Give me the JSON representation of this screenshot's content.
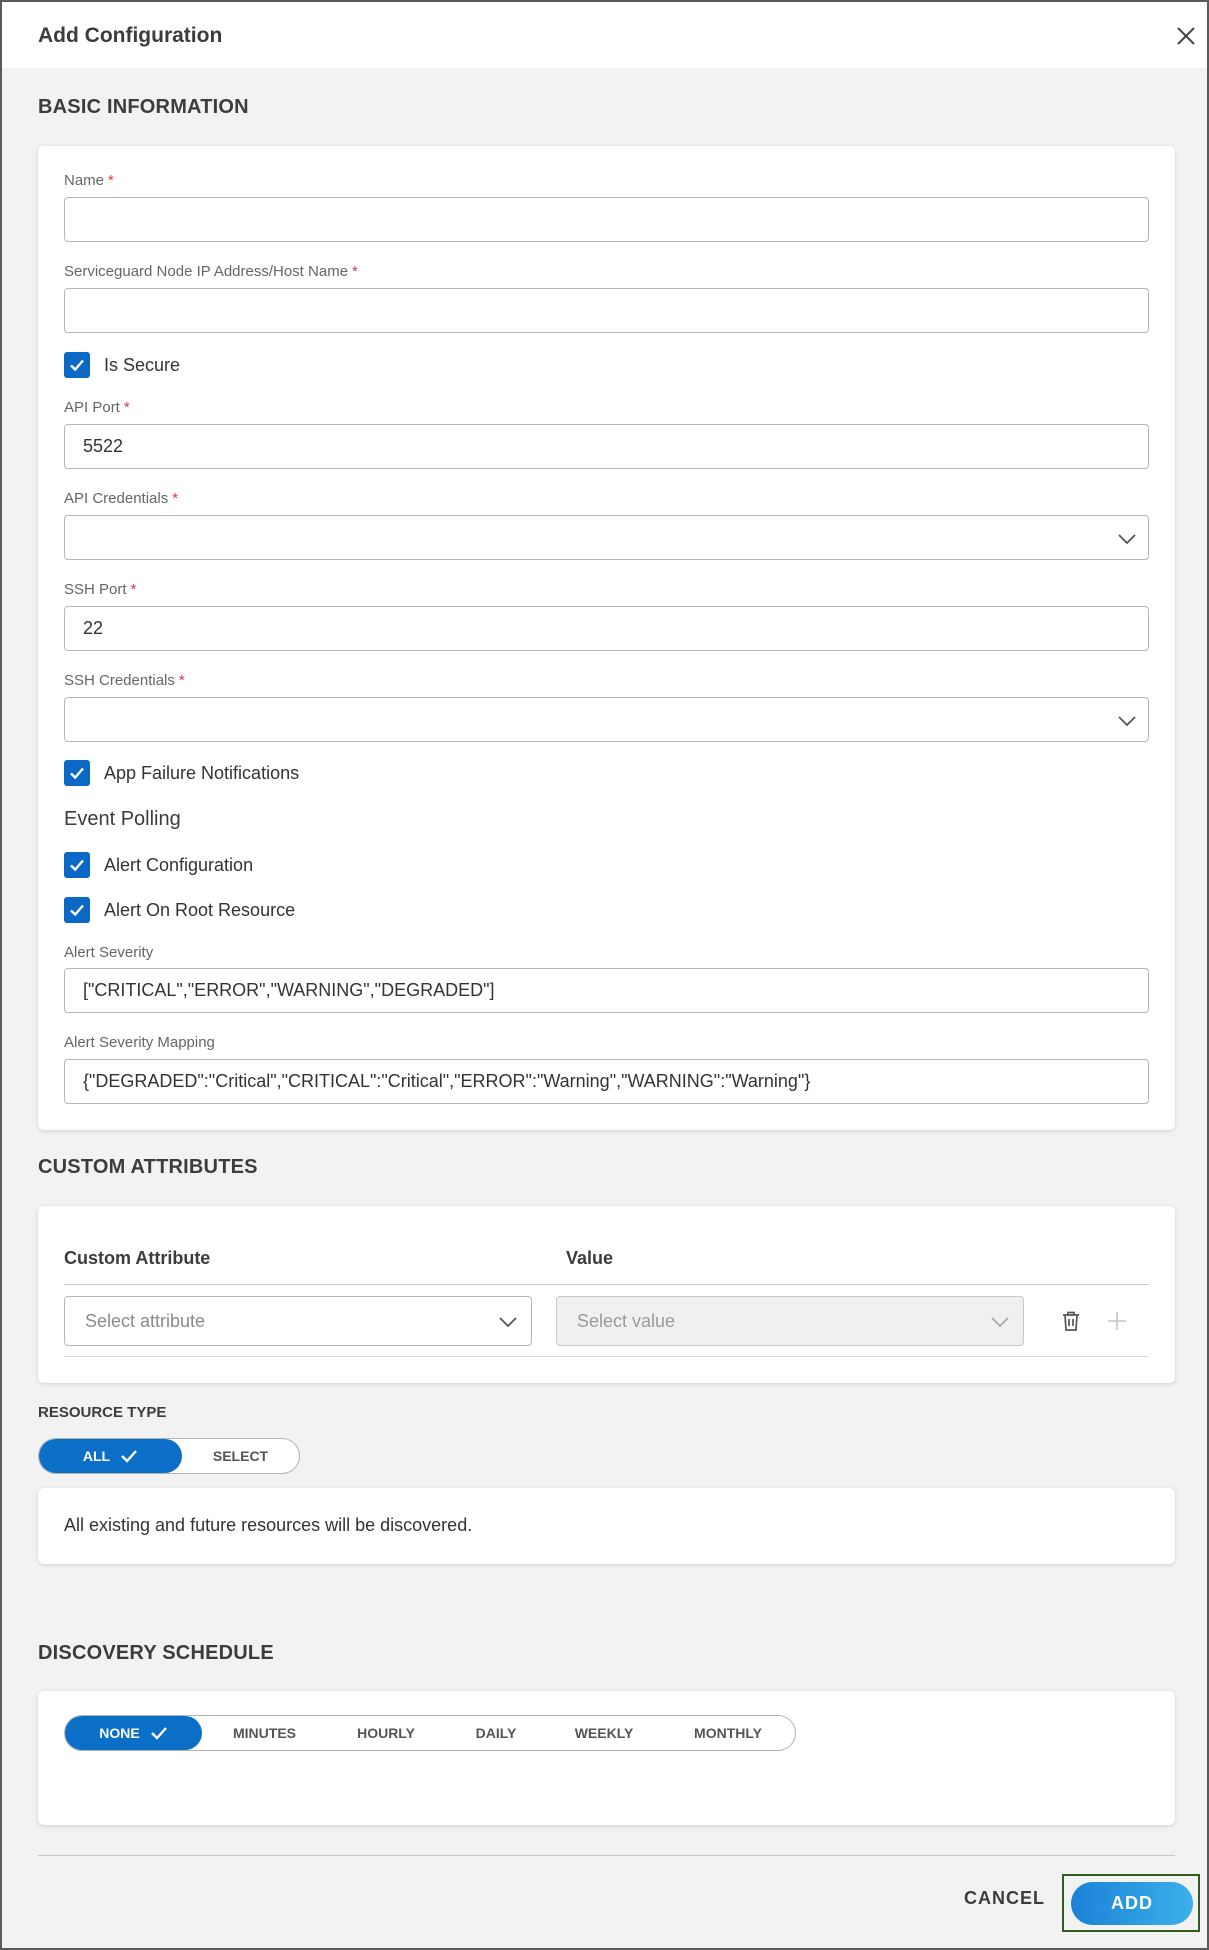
{
  "dialog": {
    "title": "Add Configuration"
  },
  "basic": {
    "title": "BASIC INFORMATION",
    "name": {
      "label": "Name",
      "value": ""
    },
    "host": {
      "label": "Serviceguard Node IP Address/Host Name",
      "value": ""
    },
    "is_secure": {
      "label": "Is Secure",
      "checked": true
    },
    "api_port": {
      "label": "API Port",
      "value": "5522"
    },
    "api_credentials": {
      "label": "API Credentials",
      "value": ""
    },
    "ssh_port": {
      "label": "SSH Port",
      "value": "22"
    },
    "ssh_credentials": {
      "label": "SSH Credentials",
      "value": ""
    },
    "app_failure": {
      "label": "App Failure Notifications",
      "checked": true
    },
    "event_polling": {
      "title": "Event Polling"
    },
    "alert_config": {
      "label": "Alert Configuration",
      "checked": true
    },
    "alert_root": {
      "label": "Alert On Root Resource",
      "checked": true
    },
    "alert_severity": {
      "label": "Alert Severity",
      "value": "[\"CRITICAL\",\"ERROR\",\"WARNING\",\"DEGRADED\"]"
    },
    "alert_mapping": {
      "label": "Alert Severity Mapping",
      "value": "{\"DEGRADED\":\"Critical\",\"CRITICAL\":\"Critical\",\"ERROR\":\"Warning\",\"WARNING\":\"Warning\"}"
    },
    "required_mark": "*"
  },
  "custom": {
    "title": "CUSTOM ATTRIBUTES",
    "col_attribute": "Custom Attribute",
    "col_value": "Value",
    "attribute_placeholder": "Select attribute",
    "value_placeholder": "Select value"
  },
  "resource": {
    "title": "RESOURCE TYPE",
    "options": [
      "ALL",
      "SELECT"
    ],
    "selected": "ALL",
    "description": "All existing and future resources will be discovered."
  },
  "schedule": {
    "title": "DISCOVERY SCHEDULE",
    "options": [
      "NONE",
      "MINUTES",
      "HOURLY",
      "DAILY",
      "WEEKLY",
      "MONTHLY"
    ],
    "selected": "NONE"
  },
  "footer": {
    "cancel_label": "CANCEL",
    "add_label": "ADD"
  },
  "colors": {
    "primary": "#0b6fc7",
    "required": "#d93a3a",
    "add_outline": "#2f5d1e"
  },
  "icons": [
    "close-icon",
    "chevron-down-icon",
    "checkmark-icon",
    "trash-icon",
    "plus-icon"
  ]
}
